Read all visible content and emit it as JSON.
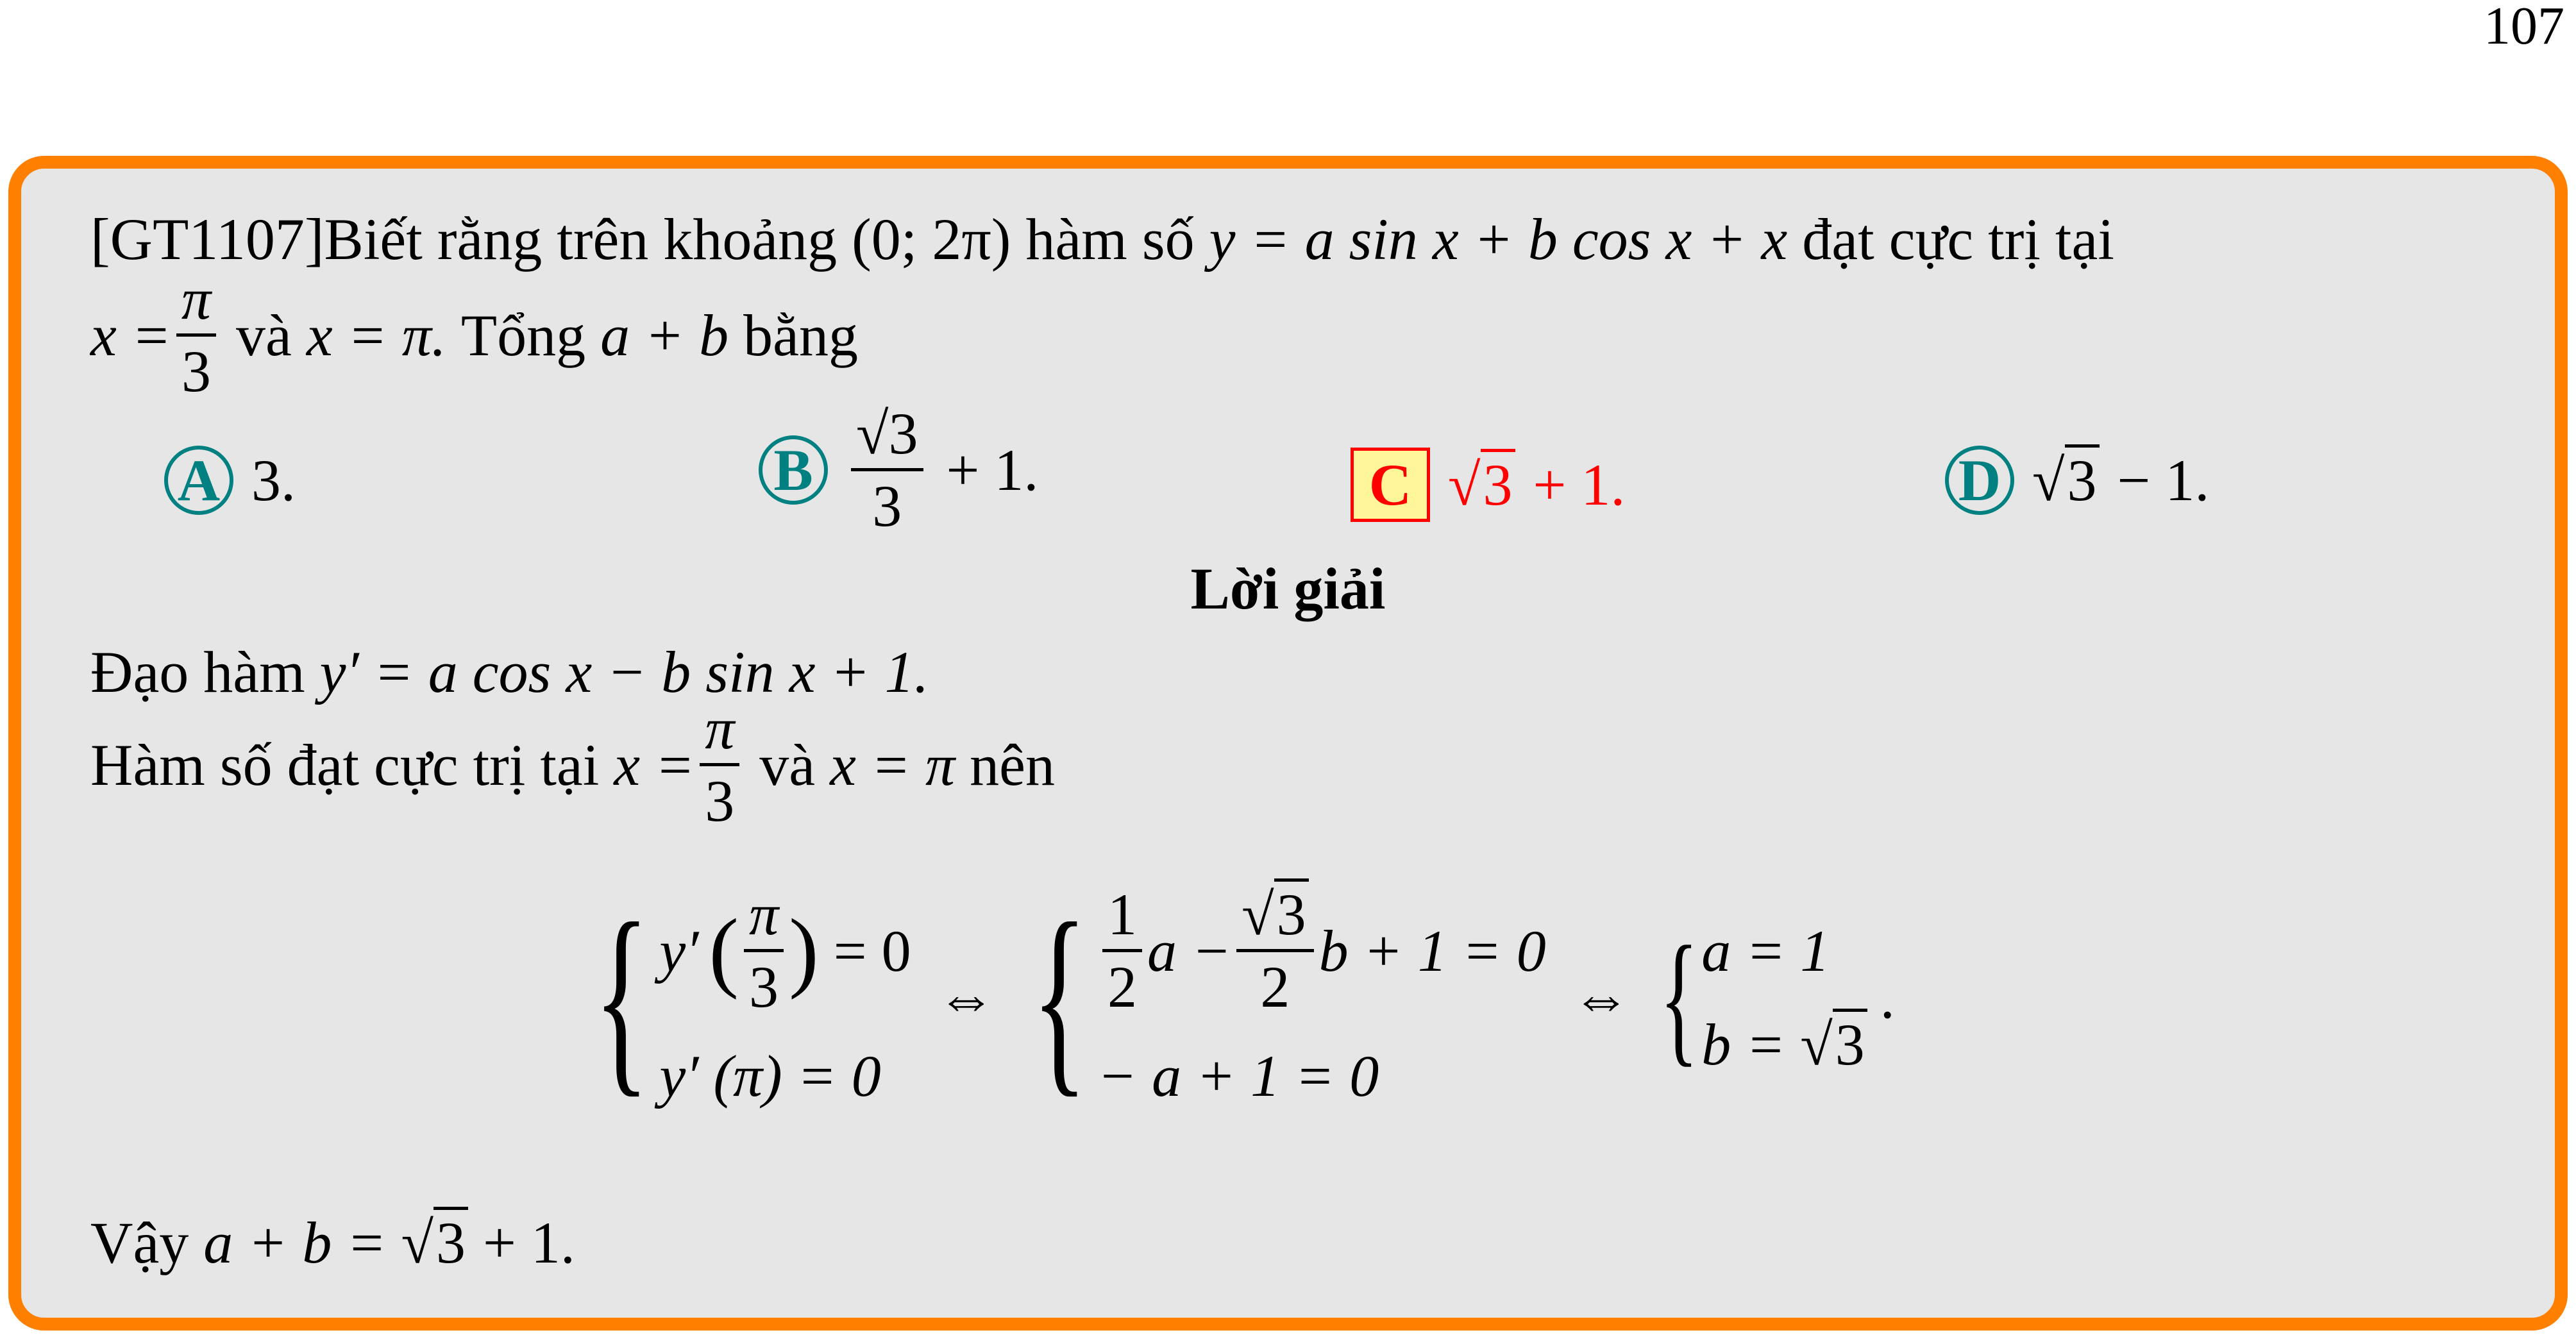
{
  "page_number": "107",
  "problem": {
    "id": "[GT1107]",
    "line1_text": "Biết rằng trên khoảng",
    "interval": "(0; 2π)",
    "line1_mid": "hàm số",
    "function": "y = a sin x + b cos x + x",
    "line1_end": "đạt cực trị tại",
    "x_eq": "x =",
    "pi": "π",
    "three": "3",
    "and": "và",
    "x_eq_pi": "x = π.",
    "question_end": "Tổng",
    "sum": "a + b",
    "question_tail": "bằng"
  },
  "options": [
    {
      "letter": "A",
      "text": "3."
    },
    {
      "letter": "B",
      "num": "√3",
      "den": "3",
      "tail": "+ 1."
    },
    {
      "letter": "C",
      "root": "3",
      "tail": "+ 1.",
      "correct": true
    },
    {
      "letter": "D",
      "root": "3",
      "tail": "− 1."
    }
  ],
  "colors": {
    "border": "#ff7f00",
    "background": "#e6e6e6",
    "option_circle": "#008080",
    "correct": "#ff0000",
    "correct_fill": "#fff599"
  },
  "solution": {
    "title": "Lời giải",
    "deriv_label": "Đạo hàm",
    "deriv": "y′ = a cos x − b sin x + 1.",
    "line2_text": "Hàm số đạt cực trị tại",
    "line2_x": "x =",
    "line2_and": "và",
    "line2_xpi": "x = π",
    "line2_end": "nên",
    "sys1": {
      "r1_left": "y′",
      "r1_right": "= 0",
      "r2": "y′ (π) = 0"
    },
    "iff": "⇔",
    "sys2": {
      "one": "1",
      "two": "2",
      "a": "a −",
      "sqrt3": "3",
      "b_tail": "b + 1 = 0",
      "r2": "− a + 1 = 0"
    },
    "sys3": {
      "r1": "a = 1",
      "r2": "b =",
      "root": "3",
      "period": "."
    },
    "conclusion_label": "Vậy",
    "conclusion": "a + b =",
    "conclusion_root": "3",
    "conclusion_tail": "+ 1."
  }
}
